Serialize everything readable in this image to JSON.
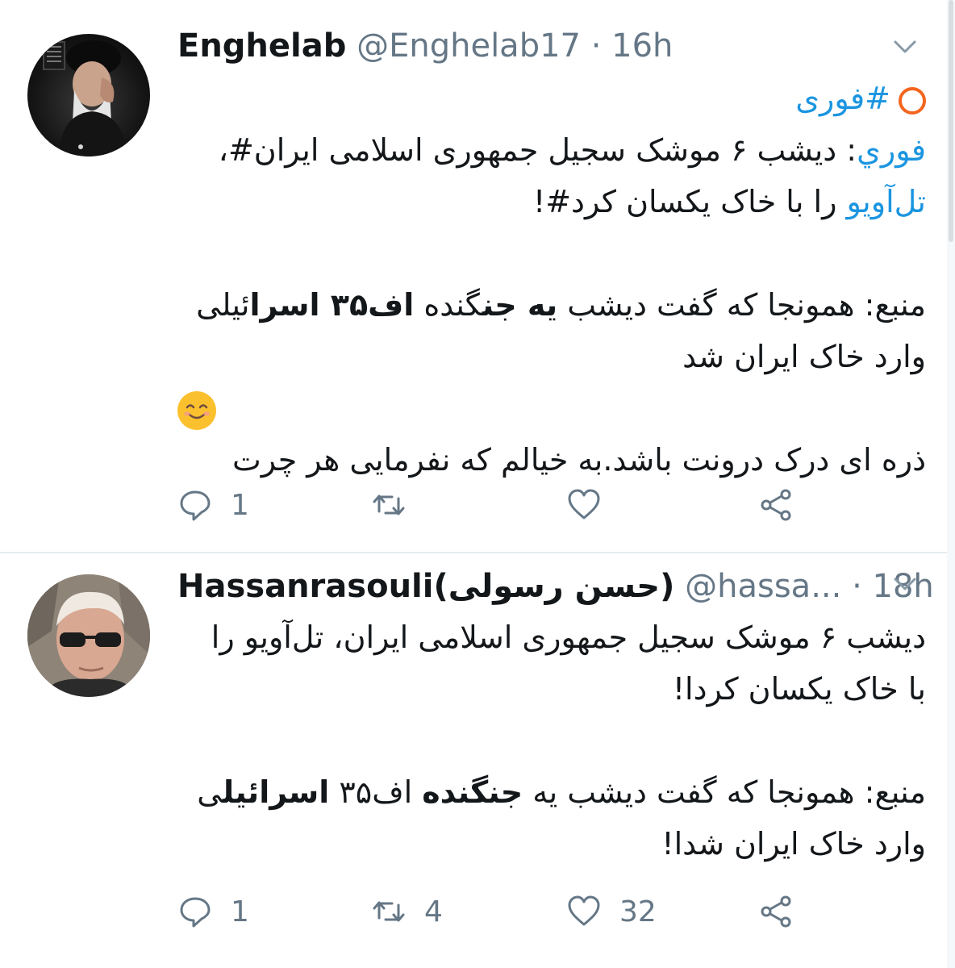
{
  "tweets": [
    {
      "display_name": "Enghelab",
      "handle": "@Enghelab17",
      "separator": "·",
      "time": "16h",
      "avatar_icon": "avatar-cleric-photo",
      "lines": [
        {
          "parts": [
            {
              "t": "#فوری",
              "link": true
            }
          ]
        },
        {
          "parts": [
            {
              "t": "فوري",
              "link": true
            },
            {
              "t": ": دیشب ۶ موشک سجیل جمهوری اسلامی ایران#،"
            }
          ]
        },
        {
          "parts": [
            {
              "t": "تل‌آویو",
              "link": true
            },
            {
              "t": " را با خاک یکسان کرد#!"
            }
          ]
        },
        {
          "parts": []
        },
        {
          "parts": [
            {
              "t": "منبع: همونجا که گفت دیشب "
            },
            {
              "t": "یه جن",
              "bold": true
            },
            {
              "t": "گنده "
            },
            {
              "t": "اف۳۵ اسرا",
              "bold": true
            },
            {
              "t": "ئیلی"
            }
          ]
        },
        {
          "parts": [
            {
              "t": "وارد خاک ایران شد"
            }
          ]
        },
        {
          "emoji": "smiling-face-emoji"
        },
        {
          "parts": [
            {
              "t": "ذره ای درک درونت باشد.به خیالم که نفرمایی هر چرت"
            }
          ]
        }
      ],
      "reply_count": "1",
      "retweet_count": "",
      "like_count": ""
    },
    {
      "display_name": "Hassanrasouli(حسن رسولی)",
      "handle": "@hassa...",
      "separator": "·",
      "time": "18h",
      "avatar_icon": "avatar-man-sunglasses-photo",
      "lines": [
        {
          "parts": [
            {
              "t": "دیشب ۶ موشک سجیل جمهوری اسلامی ایران، تل‌آویو را"
            }
          ]
        },
        {
          "parts": [
            {
              "t": "با خاک یکسان کردا!"
            }
          ]
        },
        {
          "parts": []
        },
        {
          "parts": [
            {
              "t": "منبع: همونجا که گفت دیشب یه "
            },
            {
              "t": "جنگنده",
              "bold": true
            },
            {
              "t": " اف۳۵ "
            },
            {
              "t": "اسرائیل",
              "bold": true
            },
            {
              "t": "ی"
            }
          ]
        },
        {
          "parts": [
            {
              "t": "وارد خاک ایران شدا!"
            }
          ]
        }
      ],
      "reply_count": "1",
      "retweet_count": "4",
      "like_count": "32"
    }
  ],
  "icons": {
    "reply": "reply-icon",
    "retweet": "retweet-icon",
    "like": "heart-icon",
    "share": "share-icon",
    "menu": "chevron-down-icon"
  },
  "colors": {
    "link": "#1b95e0",
    "text": "#14171a",
    "muted": "#657786",
    "ring": "#f4651f",
    "divider": "#e6ecf0"
  }
}
